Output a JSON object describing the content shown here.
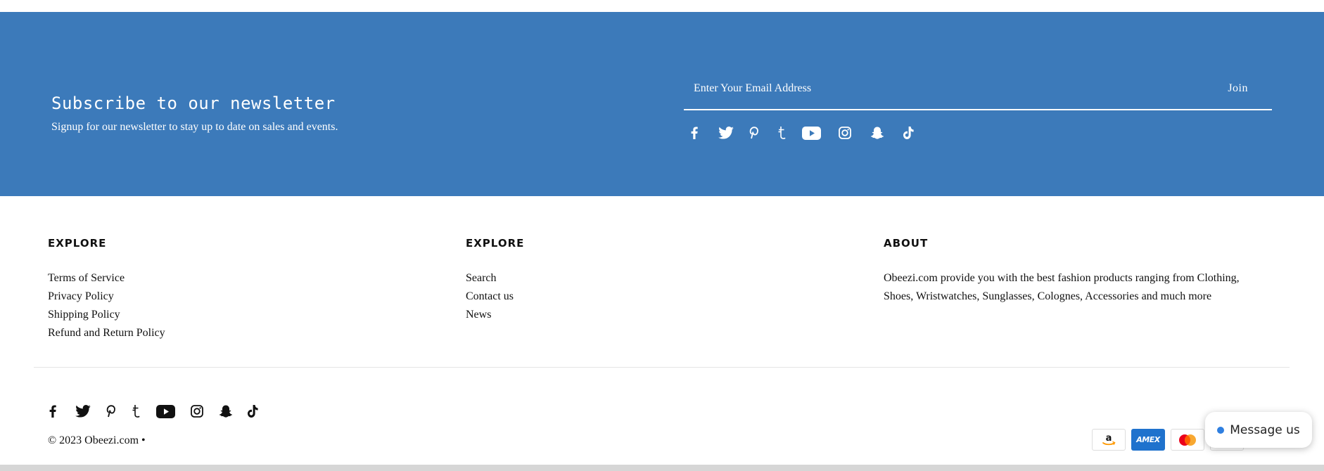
{
  "newsletter": {
    "title": "Subscribe to our newsletter",
    "subtitle": "Signup for our newsletter to stay up to date on sales and events.",
    "email_placeholder": "Enter Your Email Address",
    "join_label": "Join",
    "background_color": "#3c7aba"
  },
  "social_icons": [
    "facebook-icon",
    "twitter-icon",
    "pinterest-icon",
    "tumblr-icon",
    "youtube-icon",
    "instagram-icon",
    "snapchat-icon",
    "tiktok-icon"
  ],
  "footer": {
    "columns": [
      {
        "title": "EXPLORE",
        "links": [
          "Terms of Service",
          "Privacy Policy",
          "Shipping Policy",
          "Refund and Return Policy"
        ]
      },
      {
        "title": "EXPLORE",
        "links": [
          "Search",
          "Contact us",
          "News"
        ]
      },
      {
        "title": "ABOUT",
        "text": "Obeezi.com provide you with the best fashion products ranging from Clothing, Shoes, Wristwatches, Sunglasses, Colognes, Accessories and much more"
      }
    ],
    "copyright": "© 2023 Obeezi.com •",
    "payment_icons": [
      "amazon-pay-icon",
      "amex-icon",
      "mastercard-icon",
      "payment-icon"
    ],
    "amex_label": "AMEX"
  },
  "chat": {
    "label": "Message us",
    "dot_color": "#2f7fe0"
  }
}
